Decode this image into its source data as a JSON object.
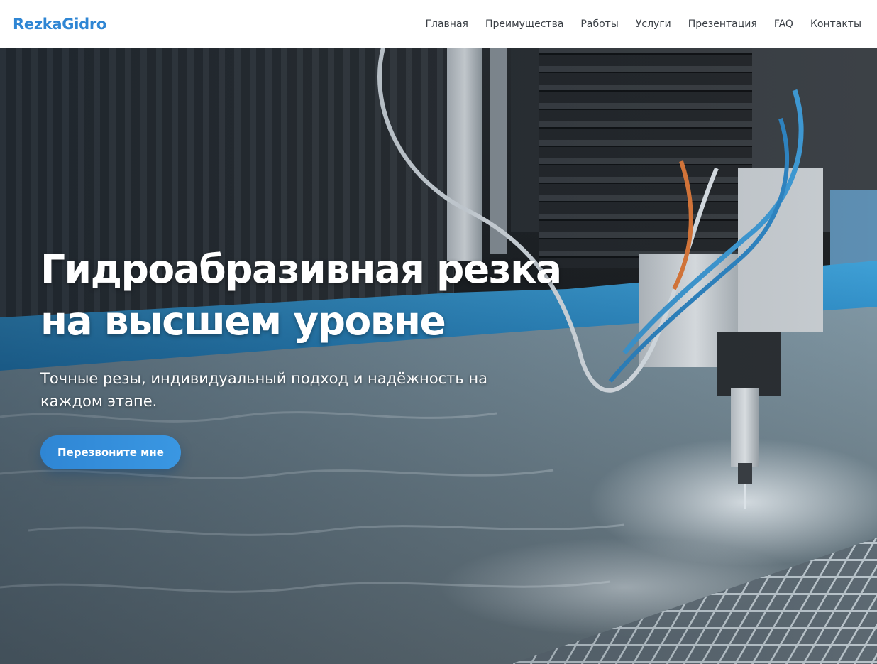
{
  "brand": {
    "logo_text": "RezkaGidro",
    "accent_color": "#2f86d4"
  },
  "nav": {
    "items": [
      {
        "label": "Главная"
      },
      {
        "label": "Преимущества"
      },
      {
        "label": "Работы"
      },
      {
        "label": "Услуги"
      },
      {
        "label": "Презентация"
      },
      {
        "label": "FAQ"
      },
      {
        "label": "Контакты"
      }
    ]
  },
  "hero": {
    "title_line1": "Гидроабразивная резка",
    "title_line2": "на высшем уровне",
    "subtitle": "Точные резы, индивидуальный подход и надёжность на каждом этапе.",
    "cta_label": "Перезвоните мне",
    "background": "waterjet-cutting-machine-photo"
  }
}
